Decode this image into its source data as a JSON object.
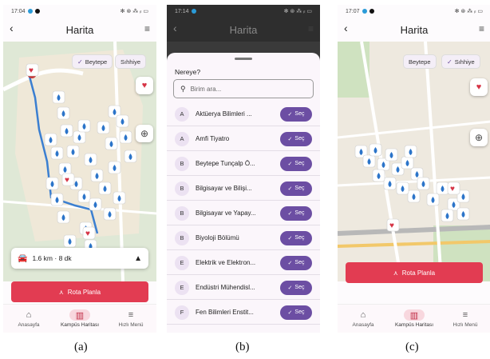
{
  "panels": {
    "a": {
      "status": {
        "time": "17:04",
        "icons": "✻ ⊛ ⁂ ᵢₗ ▭"
      },
      "title": "Harita",
      "chips": [
        "Beytepe",
        "Sıhhiye"
      ],
      "route": {
        "distance": "1.6 km",
        "separator": "·",
        "duration": "8 dk"
      },
      "plan_button": "Rota Planla",
      "nav": [
        "Anasayfa",
        "Kampüs Haritası",
        "Hızlı Menü"
      ],
      "caption": "(a)"
    },
    "b": {
      "status": {
        "time": "17:14",
        "icons": "✻ ⊛ ⁂ ᵢₗ ▭"
      },
      "title": "Harita",
      "sheet_title": "Nereye?",
      "search_placeholder": "Birim ara...",
      "select_label": "Seç",
      "items": [
        {
          "letter": "A",
          "name": "Aktüerya Bilimleri ..."
        },
        {
          "letter": "A",
          "name": "Amfi Tiyatro"
        },
        {
          "letter": "B",
          "name": "Beytepe Tunçalp Ö..."
        },
        {
          "letter": "B",
          "name": "Bilgisayar ve Bilişi..."
        },
        {
          "letter": "B",
          "name": "Bilgisayar ve Yapay..."
        },
        {
          "letter": "B",
          "name": "Biyoloji Bölümü"
        },
        {
          "letter": "E",
          "name": "Elektrik ve Elektron..."
        },
        {
          "letter": "E",
          "name": "Endüstri Mühendisl..."
        },
        {
          "letter": "F",
          "name": "Fen Bilimleri Enstit..."
        }
      ],
      "caption": "(b)"
    },
    "c": {
      "status": {
        "time": "17:07",
        "icons": "✻ ⊛ ⁂ ᵢₗ ▭"
      },
      "title": "Harita",
      "chips": [
        "Beytepe",
        "Sıhhiye"
      ],
      "plan_button": "Rota Planla",
      "nav": [
        "Anasayfa",
        "Kampüs Haritası",
        "Hızlı Menü"
      ],
      "caption": "(c)"
    }
  },
  "colors": {
    "accent": "#6c4ea3",
    "plan_button": "#e23c52",
    "marker": "#2b74c9",
    "route": "#3b7fd1",
    "heart": "#d63445"
  }
}
